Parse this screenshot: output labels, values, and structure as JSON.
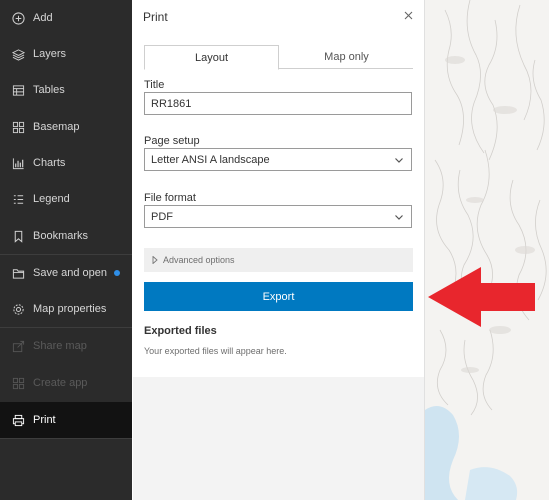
{
  "nav": {
    "items": [
      {
        "label": "Add",
        "icon": "add-circle-icon"
      },
      {
        "label": "Layers",
        "icon": "layers-icon"
      },
      {
        "label": "Tables",
        "icon": "table-icon"
      },
      {
        "label": "Basemap",
        "icon": "basemap-icon"
      },
      {
        "label": "Charts",
        "icon": "chart-icon"
      },
      {
        "label": "Legend",
        "icon": "legend-icon"
      },
      {
        "label": "Bookmarks",
        "icon": "bookmark-icon"
      },
      {
        "label": "Save and open",
        "icon": "folder-icon"
      },
      {
        "label": "Map properties",
        "icon": "gear-icon"
      },
      {
        "label": "Share map",
        "icon": "share-icon"
      },
      {
        "label": "Create app",
        "icon": "grid-icon"
      },
      {
        "label": "Print",
        "icon": "printer-icon"
      }
    ],
    "active": "Print",
    "notification_color": "#2f8fe8"
  },
  "print_panel": {
    "title": "Print",
    "close_icon": "close-icon",
    "tabs": [
      {
        "label": "Layout",
        "selected": true
      },
      {
        "label": "Map only",
        "selected": false
      }
    ],
    "title_label": "Title",
    "title_value": "RR1861",
    "page_setup_label": "Page setup",
    "page_setup_value": "Letter ANSI A landscape",
    "file_format_label": "File format",
    "file_format_value": "PDF",
    "advanced_label": "Advanced options",
    "export_label": "Export",
    "exported_files_title": "Exported files",
    "exported_files_note": "Your exported files will appear here."
  },
  "colors": {
    "nav_bg": "#2b2b2b",
    "accent": "#0079c1",
    "annotation_arrow": "#e8262d"
  }
}
